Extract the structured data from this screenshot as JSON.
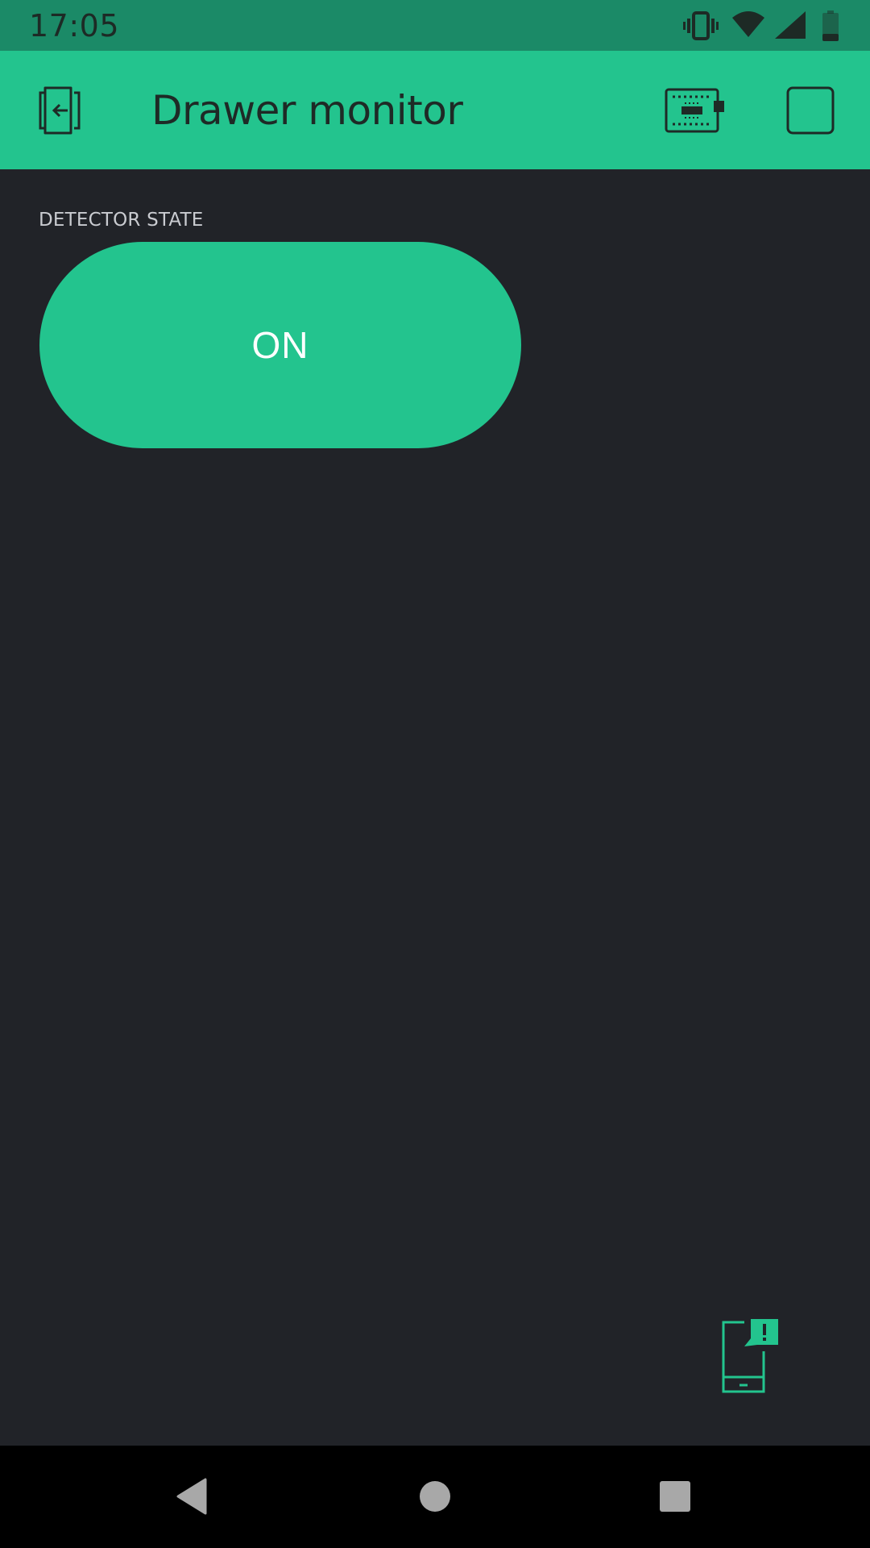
{
  "status_bar": {
    "time": "17:05",
    "icons": [
      "vibrate-icon",
      "wifi-icon",
      "cell-signal-icon",
      "battery-icon"
    ]
  },
  "app_bar": {
    "title": "Drawer monitor",
    "exit_icon": "exit-icon",
    "device_icon": "device-board-icon",
    "action_icon": "square-outline-icon"
  },
  "widget": {
    "label": "DETECTOR STATE",
    "button_label": "ON"
  },
  "colors": {
    "accent": "#23c48e",
    "status_bar": "#1b8a67",
    "background": "#212328",
    "nav_bar": "#000000"
  },
  "nav_bar": {
    "icons": [
      "back-icon",
      "home-icon",
      "recents-icon"
    ]
  }
}
